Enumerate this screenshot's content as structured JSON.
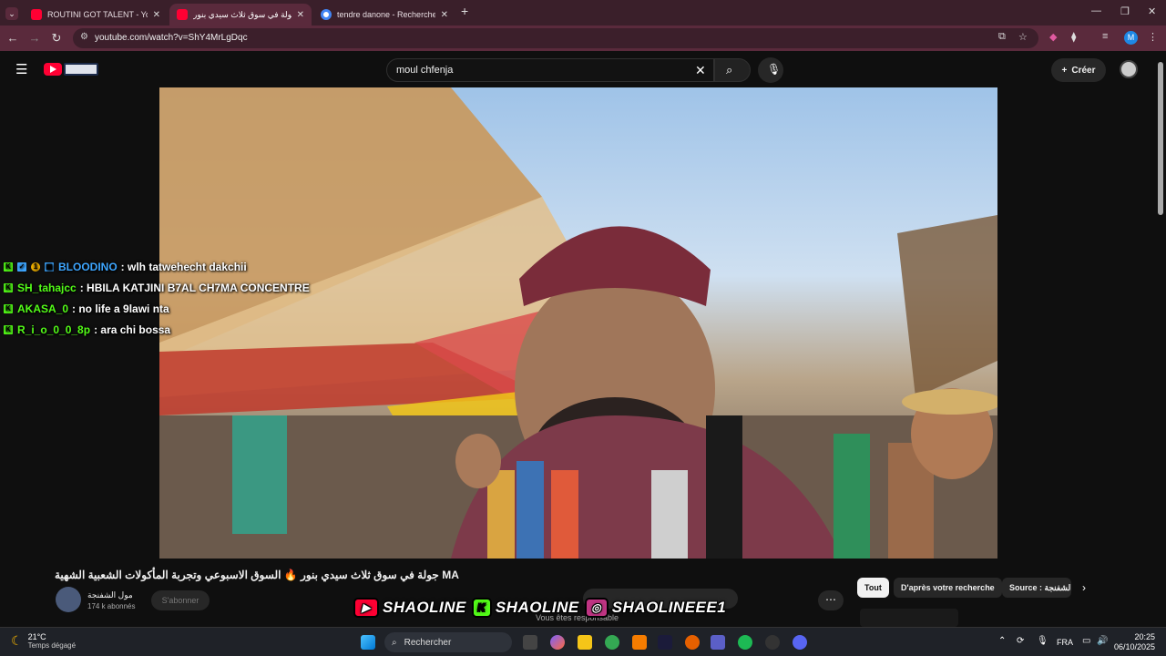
{
  "browser": {
    "tabs": [
      {
        "title": "ROUTINI GOT TALENT - YouTube",
        "favicon": "youtube-icon"
      },
      {
        "title": "جولة في سوق ثلاث سيدي بنور",
        "favicon": "youtube-icon",
        "active": true
      },
      {
        "title": "tendre danone - Recherche Google",
        "favicon": "google-icon"
      }
    ],
    "url": "youtube.com/watch?v=ShY4MrLgDqc",
    "profile_initial": "M"
  },
  "youtube": {
    "search_value": "moul chfenja",
    "create_label": "Créer",
    "chat": [
      {
        "user": "BLOODINO",
        "text": ": wlh tatwehecht dakchii",
        "color": "#3ea6ff"
      },
      {
        "user": "SH_tahajcc",
        "text": ": HBILA KATJINI B7AL CH7MA CONCENTRE",
        "color": "#53fc18"
      },
      {
        "user": "AKASA_0",
        "text": ": no life a 9lawi nta",
        "color": "#53fc18"
      },
      {
        "user": "R_i_o_0_0_8p",
        "text": ": ara chi bossa",
        "color": "#53fc18"
      }
    ],
    "video_title": "جولة في سوق ثلاث سيدي بنور 🔥 السوق الاسبوعي وتجربة المأكولات الشعبية الشهية MA",
    "channel_name": "مول الشفنجة",
    "subscribers": "174 k abonnés",
    "subscribe_label": "S'abonner",
    "chips": [
      "Tout",
      "D'après votre recherche",
      "Source : الشفنجة"
    ],
    "responsible_text": "Vous êtes responsable",
    "social": [
      "SHAOLINE",
      "SHAOLINE",
      "SHAOLINEEE1"
    ]
  },
  "taskbar": {
    "temp": "21°C",
    "weather_desc": "Temps dégagé",
    "search_placeholder": "Rechercher",
    "lang": "FRA",
    "time": "20:25",
    "date": "06/10/2025"
  },
  "colors": {
    "youtube_red": "#ff0033",
    "kick_green": "#53fc18",
    "tab_bg": "#3a1f2a",
    "address_bg": "#5a2a3c"
  }
}
